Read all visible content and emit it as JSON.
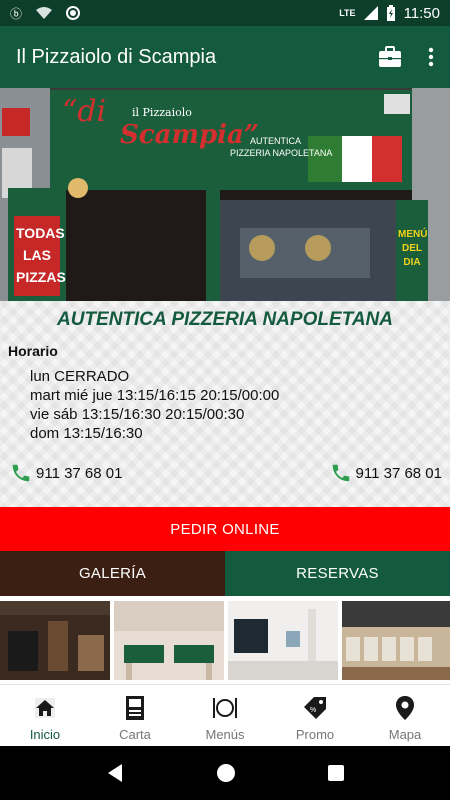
{
  "status": {
    "time": "11:50",
    "network": "LTE"
  },
  "appbar": {
    "title": "Il Pizzaiolo di Scampia"
  },
  "hero": {
    "sign_small": "il Pizzaiolo",
    "sign_di": "“di",
    "sign_scampia": "Scampia”",
    "sign_line1": "AUTENTICA",
    "sign_line2": "PIZZERIA NAPOLETANA",
    "banner_lines": [
      "TODAS",
      "LAS",
      "PIZZAS"
    ],
    "menu_board": [
      "MENÚ",
      "DEL",
      "DIA"
    ]
  },
  "info": {
    "tagline": "AUTENTICA PIZZERIA NAPOLETANA",
    "hours_label": "Horario",
    "hours": [
      "lun CERRADO",
      "mart mié jue 13:15/16:15 20:15/00:00",
      "vie sáb 13:15/16:30 20:15/00:30",
      "dom 13:15/16:30"
    ],
    "phone_left": "911 37 68 01",
    "phone_right": "911 37 68 01"
  },
  "order_label": "PEDIR ONLINE",
  "tabs": {
    "gallery": "GALERÍA",
    "reservas": "RESERVAS"
  },
  "nav": [
    {
      "label": "Inicio",
      "icon": "home-icon"
    },
    {
      "label": "Carta",
      "icon": "menu-card-icon"
    },
    {
      "label": "Menús",
      "icon": "cutlery-icon"
    },
    {
      "label": "Promo",
      "icon": "promo-tag-icon"
    },
    {
      "label": "Mapa",
      "icon": "map-pin-icon"
    }
  ],
  "colors": {
    "primary": "#145a3f",
    "dark": "#0d3d2b",
    "accent": "#ff0000",
    "gallery": "#3a1f12"
  }
}
